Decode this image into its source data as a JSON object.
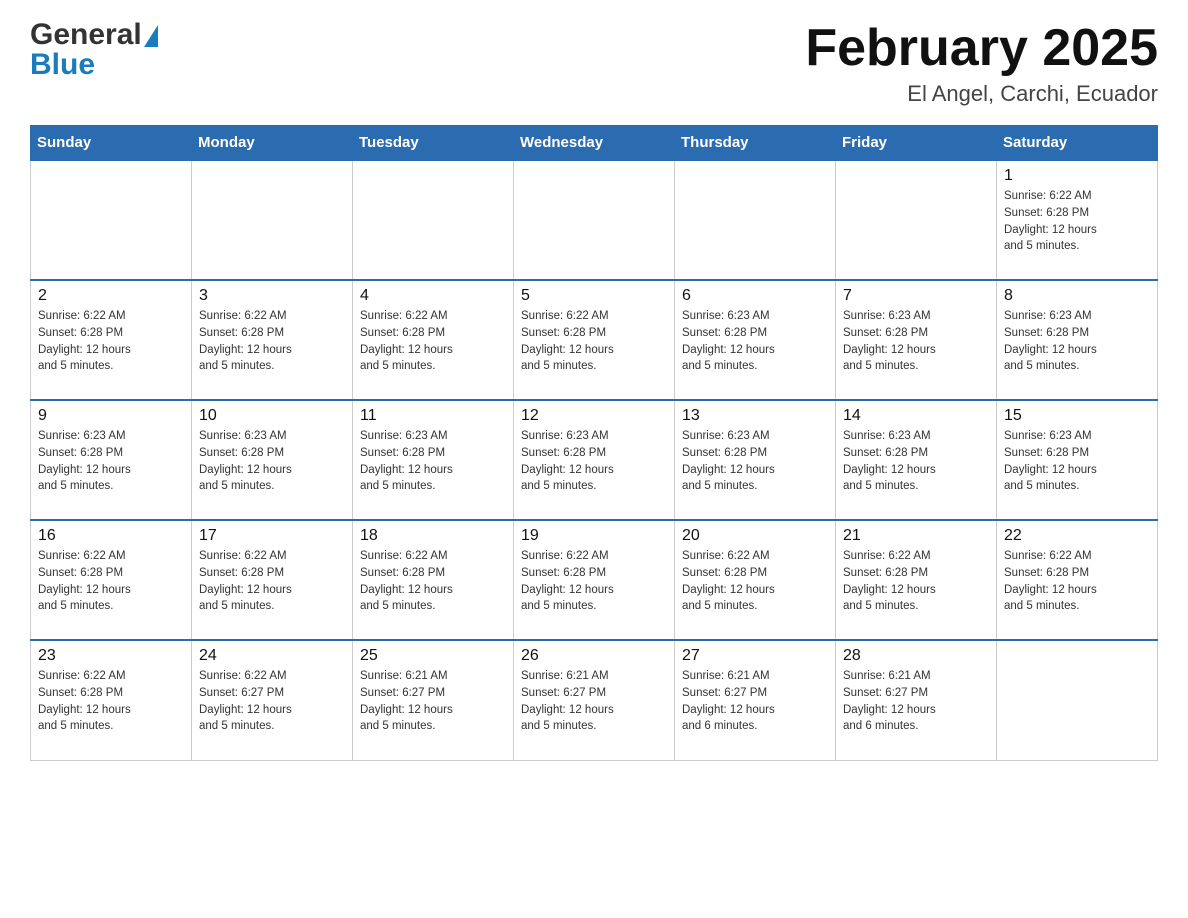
{
  "header": {
    "logo_general": "General",
    "logo_blue": "Blue",
    "title": "February 2025",
    "subtitle": "El Angel, Carchi, Ecuador"
  },
  "days_of_week": [
    "Sunday",
    "Monday",
    "Tuesday",
    "Wednesday",
    "Thursday",
    "Friday",
    "Saturday"
  ],
  "weeks": [
    [
      {
        "day": "",
        "info": ""
      },
      {
        "day": "",
        "info": ""
      },
      {
        "day": "",
        "info": ""
      },
      {
        "day": "",
        "info": ""
      },
      {
        "day": "",
        "info": ""
      },
      {
        "day": "",
        "info": ""
      },
      {
        "day": "1",
        "info": "Sunrise: 6:22 AM\nSunset: 6:28 PM\nDaylight: 12 hours\nand 5 minutes."
      }
    ],
    [
      {
        "day": "2",
        "info": "Sunrise: 6:22 AM\nSunset: 6:28 PM\nDaylight: 12 hours\nand 5 minutes."
      },
      {
        "day": "3",
        "info": "Sunrise: 6:22 AM\nSunset: 6:28 PM\nDaylight: 12 hours\nand 5 minutes."
      },
      {
        "day": "4",
        "info": "Sunrise: 6:22 AM\nSunset: 6:28 PM\nDaylight: 12 hours\nand 5 minutes."
      },
      {
        "day": "5",
        "info": "Sunrise: 6:22 AM\nSunset: 6:28 PM\nDaylight: 12 hours\nand 5 minutes."
      },
      {
        "day": "6",
        "info": "Sunrise: 6:23 AM\nSunset: 6:28 PM\nDaylight: 12 hours\nand 5 minutes."
      },
      {
        "day": "7",
        "info": "Sunrise: 6:23 AM\nSunset: 6:28 PM\nDaylight: 12 hours\nand 5 minutes."
      },
      {
        "day": "8",
        "info": "Sunrise: 6:23 AM\nSunset: 6:28 PM\nDaylight: 12 hours\nand 5 minutes."
      }
    ],
    [
      {
        "day": "9",
        "info": "Sunrise: 6:23 AM\nSunset: 6:28 PM\nDaylight: 12 hours\nand 5 minutes."
      },
      {
        "day": "10",
        "info": "Sunrise: 6:23 AM\nSunset: 6:28 PM\nDaylight: 12 hours\nand 5 minutes."
      },
      {
        "day": "11",
        "info": "Sunrise: 6:23 AM\nSunset: 6:28 PM\nDaylight: 12 hours\nand 5 minutes."
      },
      {
        "day": "12",
        "info": "Sunrise: 6:23 AM\nSunset: 6:28 PM\nDaylight: 12 hours\nand 5 minutes."
      },
      {
        "day": "13",
        "info": "Sunrise: 6:23 AM\nSunset: 6:28 PM\nDaylight: 12 hours\nand 5 minutes."
      },
      {
        "day": "14",
        "info": "Sunrise: 6:23 AM\nSunset: 6:28 PM\nDaylight: 12 hours\nand 5 minutes."
      },
      {
        "day": "15",
        "info": "Sunrise: 6:23 AM\nSunset: 6:28 PM\nDaylight: 12 hours\nand 5 minutes."
      }
    ],
    [
      {
        "day": "16",
        "info": "Sunrise: 6:22 AM\nSunset: 6:28 PM\nDaylight: 12 hours\nand 5 minutes."
      },
      {
        "day": "17",
        "info": "Sunrise: 6:22 AM\nSunset: 6:28 PM\nDaylight: 12 hours\nand 5 minutes."
      },
      {
        "day": "18",
        "info": "Sunrise: 6:22 AM\nSunset: 6:28 PM\nDaylight: 12 hours\nand 5 minutes."
      },
      {
        "day": "19",
        "info": "Sunrise: 6:22 AM\nSunset: 6:28 PM\nDaylight: 12 hours\nand 5 minutes."
      },
      {
        "day": "20",
        "info": "Sunrise: 6:22 AM\nSunset: 6:28 PM\nDaylight: 12 hours\nand 5 minutes."
      },
      {
        "day": "21",
        "info": "Sunrise: 6:22 AM\nSunset: 6:28 PM\nDaylight: 12 hours\nand 5 minutes."
      },
      {
        "day": "22",
        "info": "Sunrise: 6:22 AM\nSunset: 6:28 PM\nDaylight: 12 hours\nand 5 minutes."
      }
    ],
    [
      {
        "day": "23",
        "info": "Sunrise: 6:22 AM\nSunset: 6:28 PM\nDaylight: 12 hours\nand 5 minutes."
      },
      {
        "day": "24",
        "info": "Sunrise: 6:22 AM\nSunset: 6:27 PM\nDaylight: 12 hours\nand 5 minutes."
      },
      {
        "day": "25",
        "info": "Sunrise: 6:21 AM\nSunset: 6:27 PM\nDaylight: 12 hours\nand 5 minutes."
      },
      {
        "day": "26",
        "info": "Sunrise: 6:21 AM\nSunset: 6:27 PM\nDaylight: 12 hours\nand 5 minutes."
      },
      {
        "day": "27",
        "info": "Sunrise: 6:21 AM\nSunset: 6:27 PM\nDaylight: 12 hours\nand 6 minutes."
      },
      {
        "day": "28",
        "info": "Sunrise: 6:21 AM\nSunset: 6:27 PM\nDaylight: 12 hours\nand 6 minutes."
      },
      {
        "day": "",
        "info": ""
      }
    ]
  ]
}
